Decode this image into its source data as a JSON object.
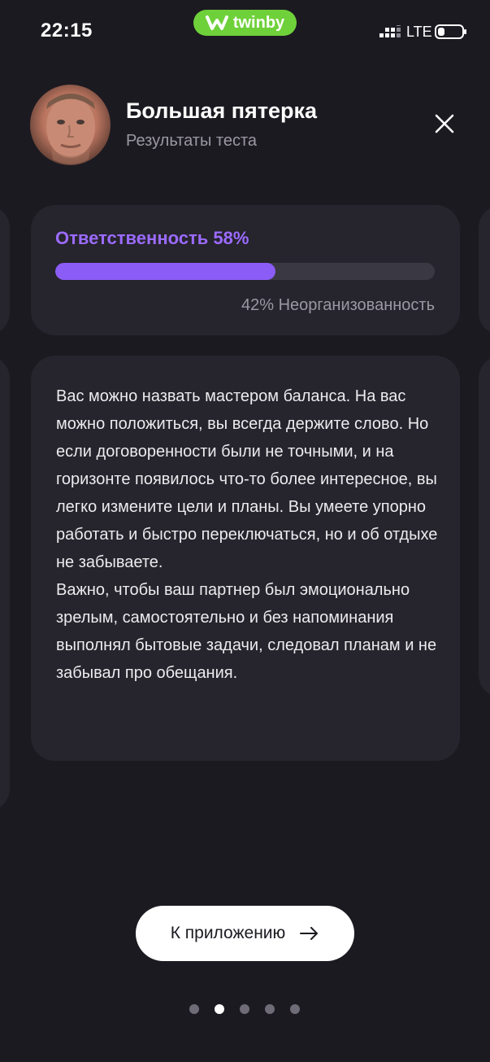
{
  "status_bar": {
    "time": "22:15",
    "brand": "twinby",
    "network": "LTE",
    "icons": [
      "signal-icon",
      "battery-icon"
    ]
  },
  "header": {
    "title": "Большая пятерка",
    "subtitle": "Результаты теста"
  },
  "score": {
    "title": "Ответственность 58%",
    "percent": 58,
    "opposite": "42% Неорганизованность",
    "accent_color": "#8b5cf6"
  },
  "description": {
    "paragraph_1": "Вас можно назвать мастером баланса. На вас можно положиться, вы всегда держите слово. Но если договоренности были не точными, и на горизонте появилось что-то более интересное, вы легко измените цели и планы. Вы умеете упорно работать и быстро переключаться, но и об отдыхе не забываете.",
    "paragraph_2": "Важно, чтобы ваш партнер был эмоционально зрелым, самостоятельно и без напоминания выполнял бытовые задачи, следовал планам и не забывал про обещания."
  },
  "cta": {
    "label": "К приложению",
    "icon": "arrow-right-icon"
  },
  "pagination": {
    "total": 5,
    "active_index": 1
  },
  "colors": {
    "background": "#1c1a21",
    "card": "#26242c",
    "brand_green": "#6fd13a"
  }
}
